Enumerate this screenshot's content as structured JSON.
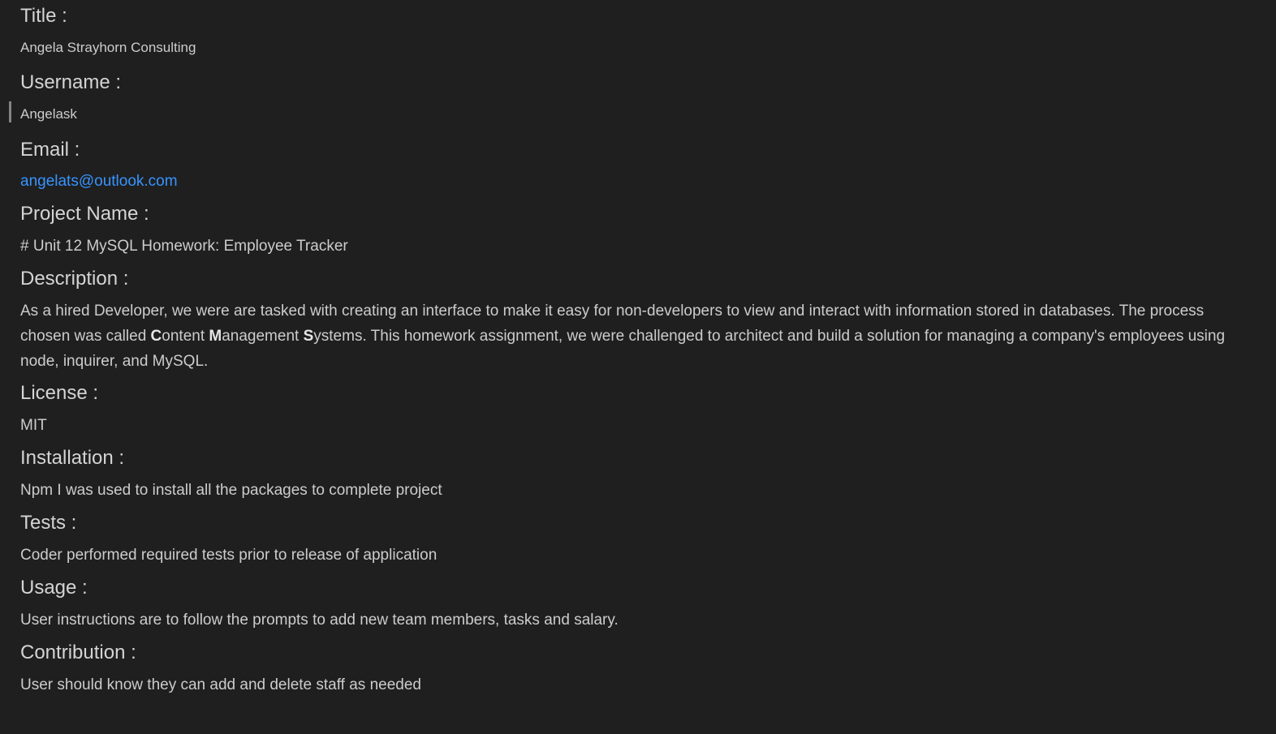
{
  "sections": {
    "title": {
      "heading": "Title :",
      "value": "Angela Strayhorn Consulting"
    },
    "username": {
      "heading": "Username :",
      "value": "Angelask"
    },
    "email": {
      "heading": "Email :",
      "value": "angelats@outlook.com"
    },
    "project_name": {
      "heading": "Project Name :",
      "value": "# Unit 12 MySQL Homework: Employee Tracker"
    },
    "description": {
      "heading": "Description :",
      "part1": "As a hired Developer, we were are tasked with creating an interface to make it easy for non-developers to view and interact with information stored in databases. The process chosen was called ",
      "c_bold": "C",
      "c_rest": "ontent ",
      "m_bold": "M",
      "m_rest": "anagement ",
      "s_bold": "S",
      "part2": "ystems. This homework assignment, we were challenged to architect and build a solution for managing a company's employees using node, inquirer, and MySQL."
    },
    "license": {
      "heading": "License :",
      "value": "MIT"
    },
    "installation": {
      "heading": "Installation :",
      "value": "Npm I was used to install all the packages to complete project"
    },
    "tests": {
      "heading": "Tests :",
      "value": "Coder performed required tests prior to release of application"
    },
    "usage": {
      "heading": "Usage :",
      "value": "User instructions are to follow the prompts to add new team members, tasks and salary."
    },
    "contribution": {
      "heading": "Contribution :",
      "value": "User should know they can add and delete staff as needed"
    }
  },
  "colors": {
    "background": "#1f1f1f",
    "text": "#cccccc",
    "heading": "#d4d4d4",
    "link": "#3794ff"
  }
}
